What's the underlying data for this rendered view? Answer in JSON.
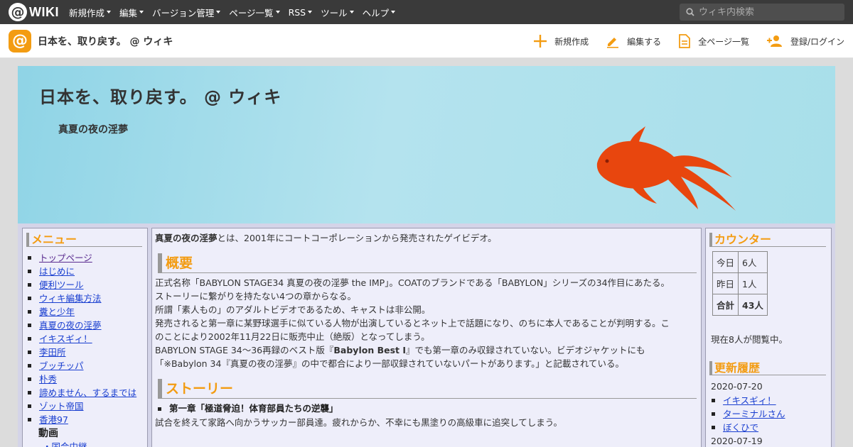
{
  "topbar": {
    "logo_text": "WIKI",
    "menu": [
      "新規作成",
      "編集",
      "バージョン管理",
      "ページ一覧",
      "RSS",
      "ツール",
      "ヘルプ"
    ],
    "search_placeholder": "ウィキ内検索"
  },
  "header": {
    "site_title": "日本を、取り戻す。 @ ウィキ",
    "actions": [
      "新規作成",
      "編集する",
      "全ページ一覧",
      "登録/ログイン"
    ]
  },
  "banner": {
    "title": "日本を、取り戻す。 @ ウィキ",
    "subtitle": "真夏の夜の淫夢"
  },
  "menu": {
    "heading": "メニュー",
    "items": [
      "トップページ",
      "はじめに",
      "便利ツール",
      "ウィキ編集方法",
      "糞と少年",
      "真夏の夜の淫夢",
      "イキスギィ！",
      "李田所",
      "ブッチッパ",
      "朴秀",
      "諦めません、するまでは",
      "ゾット帝国",
      "香港97"
    ],
    "sub_heading": "動画",
    "sub_items": [
      "国会中継"
    ]
  },
  "main": {
    "intro_bold": "真夏の夜の淫夢",
    "intro_rest": "とは、2001年にコートコーポレーションから発売されたゲイビデオ。",
    "section1_title": "概要",
    "p1": "正式名称「BABYLON STAGE34 真夏の夜の淫夢 the IMP」。COATのブランドである「BABYLON」シリーズの34作目にあたる。",
    "p2": "ストーリーに繋がりを持たない4つの章からなる。",
    "p3": "所謂「素人もの」のアダルトビデオであるため、キャストは非公開。",
    "p4": "発売されると第一章に某野球選手に似ている人物が出演しているとネット上で話題になり、のちに本人であることが判明する。こ",
    "p5": "のことにより2002年11月22日に販売中止（絶版）となってしまう。",
    "p6_a": "BABYLON STAGE 34～36再録のベスト版『",
    "p6_b": "Babylon Best I",
    "p6_c": "』でも第一章のみ収録されていない。ビデオジャケットにも",
    "p7": "「※Babylon 34『真夏の夜の淫夢』の中で都合により一部収録されていないパートがあります。」と記載されている。",
    "section2_title": "ストーリー",
    "chapter1": "第一章「極道脅迫！体育部員たちの逆襲」",
    "p8": "試合を終えて家路へ向かうサッカー部員達。疲れからか、不幸にも黒塗りの高級車に追突してしまう。"
  },
  "counter": {
    "heading": "カウンター",
    "rows": [
      {
        "label": "今日",
        "value": "6人"
      },
      {
        "label": "昨日",
        "value": "1人"
      },
      {
        "label": "合計",
        "value": "43人"
      }
    ],
    "viewing": "現在8人が閲覧中。"
  },
  "history": {
    "heading": "更新履歴",
    "date1": "2020-07-20",
    "items": [
      "イキスギィ！",
      "ターミナルさん",
      "ぼくひで"
    ],
    "date2": "2020-07-19"
  },
  "colors": {
    "accent": "#f39c12",
    "link": "#1a3fd0",
    "fish": "#e8460e"
  }
}
